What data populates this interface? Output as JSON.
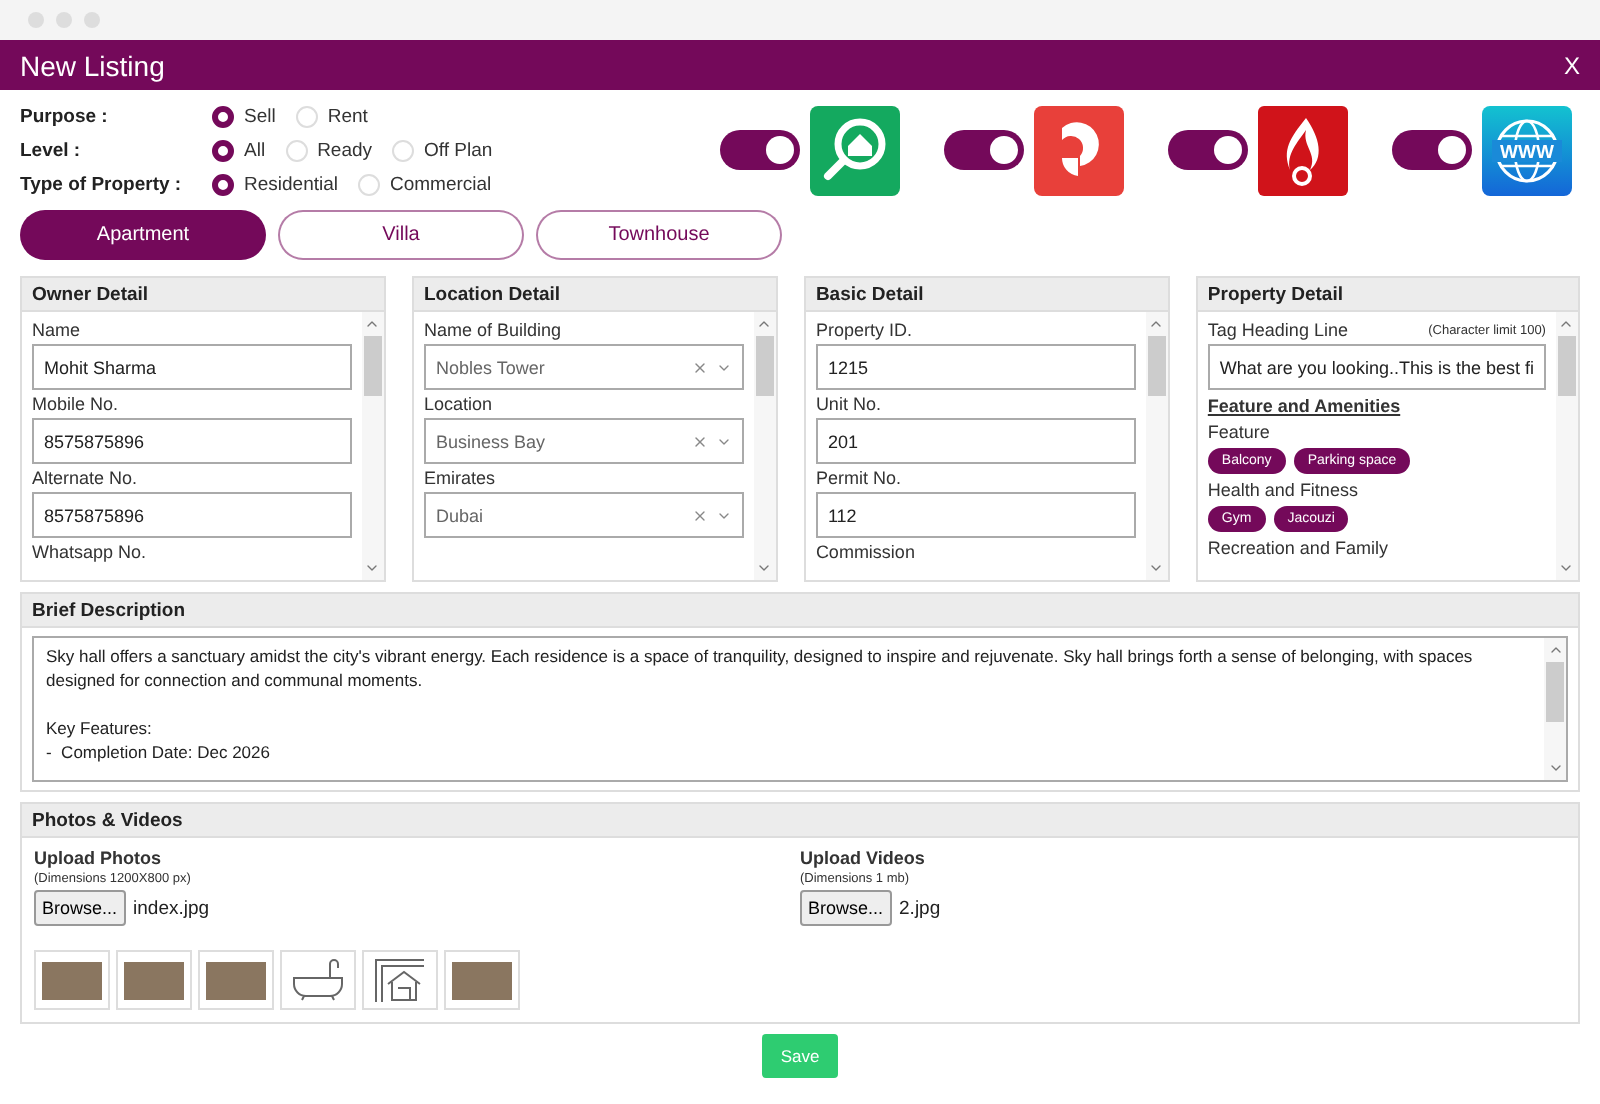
{
  "window": {
    "title": "New Listing",
    "close_label": "X"
  },
  "option_groups": [
    {
      "label": "Purpose :",
      "options": [
        {
          "label": "Sell",
          "selected": true
        },
        {
          "label": "Rent",
          "selected": false
        }
      ]
    },
    {
      "label": "Level :",
      "options": [
        {
          "label": "All",
          "selected": true
        },
        {
          "label": "Ready",
          "selected": false
        },
        {
          "label": "Off Plan",
          "selected": false
        }
      ]
    },
    {
      "label": "Type of Property :",
      "options": [
        {
          "label": "Residential",
          "selected": true
        },
        {
          "label": "Commercial",
          "selected": false
        }
      ]
    }
  ],
  "portals": [
    {
      "kind": "house-search",
      "on": true
    },
    {
      "kind": "p-mark",
      "on": true
    },
    {
      "kind": "flame",
      "on": true
    },
    {
      "kind": "globe",
      "on": true,
      "logo_text": "WWW"
    }
  ],
  "tabs": [
    {
      "label": "Apartment",
      "selected": true
    },
    {
      "label": "Villa",
      "selected": false
    },
    {
      "label": "Townhouse",
      "selected": false
    }
  ],
  "owner_detail": {
    "title": "Owner Detail",
    "fields": [
      {
        "label": "Name",
        "value": "Mohit Sharma"
      },
      {
        "label": "Mobile No.",
        "value": "8575875896"
      },
      {
        "label": "Alternate No.",
        "value": "8575875896"
      }
    ],
    "next_label": "Whatsapp No."
  },
  "location_detail": {
    "title": "Location Detail",
    "fields": [
      {
        "label": "Name of Building",
        "value": "Nobles Tower"
      },
      {
        "label": "Location",
        "value": "Business Bay"
      },
      {
        "label": "Emirates",
        "value": "Dubai"
      }
    ]
  },
  "basic_detail": {
    "title": "Basic Detail",
    "fields": [
      {
        "label": "Property ID.",
        "value": "1215"
      },
      {
        "label": "Unit No.",
        "value": "201"
      },
      {
        "label": "Permit No.",
        "value": "112"
      }
    ],
    "next_label": "Commission"
  },
  "property_detail": {
    "title": "Property Detail",
    "tag_label": "Tag Heading Line",
    "tag_hint": "(Character limit 100)",
    "tag_value": "What are you looking..This is the best fi",
    "amenities_heading": "Feature and Amenities",
    "groups": [
      {
        "label": "Feature",
        "chips": [
          "Balcony",
          "Parking space"
        ]
      },
      {
        "label": "Health and Fitness",
        "chips": [
          "Gym",
          "Jacouzi"
        ]
      }
    ],
    "next_label": "Recreation and Family"
  },
  "brief_description": {
    "title": "Brief Description",
    "text": "Sky hall offers a sanctuary amidst the city's vibrant energy. Each residence is a space of tranquility, designed to inspire and rejuvenate. Sky hall brings forth a sense of belonging, with spaces designed for connection and communal moments.\n\nKey Features:\n-  Completion Date: Dec 2026"
  },
  "photos_videos": {
    "title": "Photos & Videos",
    "photos": {
      "label": "Upload Photos",
      "hint": "(Dimensions 1200X800 px)",
      "button": "Browse...",
      "file": "index.jpg"
    },
    "videos": {
      "label": "Upload Videos",
      "hint": "(Dimensions 1 mb)",
      "button": "Browse...",
      "file": "2.jpg"
    },
    "thumbnails": [
      {
        "kind": "photo"
      },
      {
        "kind": "photo"
      },
      {
        "kind": "photo"
      },
      {
        "kind": "bathtub"
      },
      {
        "kind": "floorplan"
      },
      {
        "kind": "photo"
      }
    ]
  },
  "save_button": "Save"
}
